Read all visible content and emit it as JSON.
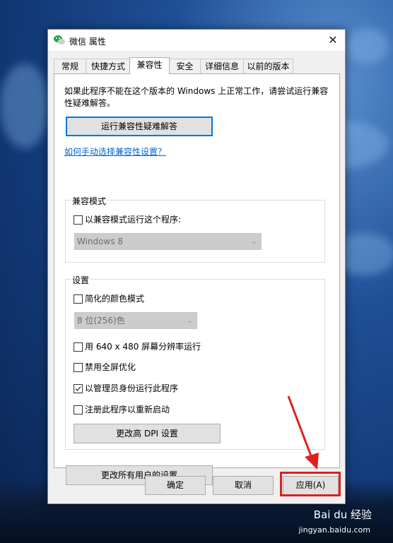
{
  "window": {
    "title": "微信 属性",
    "close": "✕"
  },
  "tabs": [
    "常规",
    "快捷方式",
    "兼容性",
    "安全",
    "详细信息",
    "以前的版本"
  ],
  "active_tab": "兼容性",
  "compat": {
    "intro": "如果此程序不能在这个版本的 Windows 上正常工作，请尝试运行兼容性疑难解答。",
    "troubleshoot_button": "运行兼容性疑难解答",
    "manual_link": "如何手动选择兼容性设置？",
    "mode_group": {
      "label": "兼容模式",
      "checkbox": "以兼容模式运行这个程序:",
      "checked": false,
      "select_value": "Windows 8"
    },
    "settings_group": {
      "label": "设置",
      "reduced_color": {
        "label": "简化的颜色模式",
        "checked": false
      },
      "color_select": "8 位(256)色",
      "resolution": {
        "label": "用 640 x 480 屏幕分辨率运行",
        "checked": false
      },
      "fullscreen_opt": {
        "label": "禁用全屏优化",
        "checked": false
      },
      "run_admin": {
        "label": "以管理员身份运行此程序",
        "checked": true
      },
      "register_restart": {
        "label": "注册此程序以重新启动",
        "checked": false
      },
      "dpi_button": "更改高 DPI 设置"
    },
    "all_users_button": "更改所有用户的设置"
  },
  "footer": {
    "ok": "确定",
    "cancel": "取消",
    "apply": "应用(A)"
  },
  "watermark": {
    "brand": "Bai du 经验",
    "sub": "jingyan.baidu.com"
  },
  "colors": {
    "accent": "#0078d7",
    "annotation": "#e02020",
    "link": "#0066cc"
  }
}
